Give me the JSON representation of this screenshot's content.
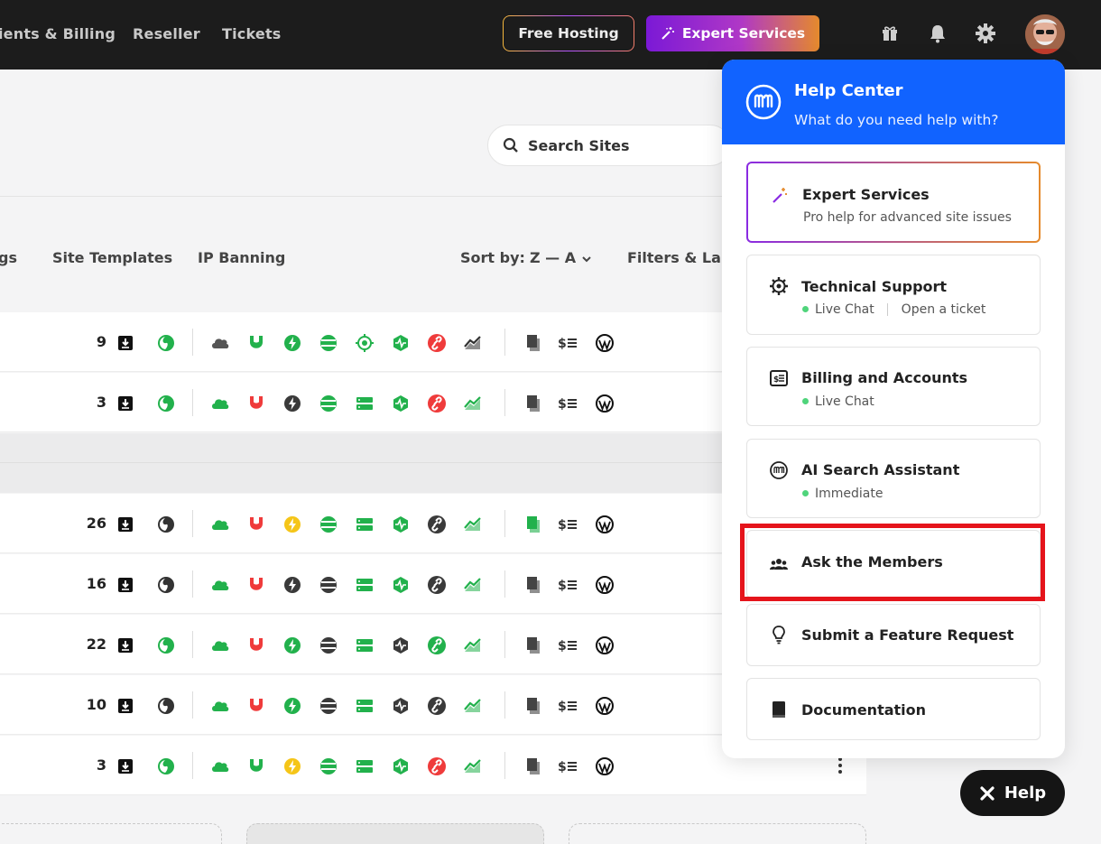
{
  "topnav": {
    "items": [
      "ients & Billing",
      "Reseller",
      "Tickets"
    ],
    "free_hosting": "Free Hosting",
    "expert_services": "Expert Services"
  },
  "search": {
    "placeholder": "Search Sites"
  },
  "toolbar": {
    "tabs": [
      "gs",
      "Site Templates",
      "IP Banning"
    ],
    "sort_label": "Sort by:",
    "sort_value": "Z — A",
    "filters": "Filters & Labe"
  },
  "sites": {
    "group1": [
      {
        "count": "9",
        "icons": [
          "backup-download",
          "globe",
          "cloud",
          "shield",
          "bolt",
          "stack",
          "gear",
          "server",
          "activity",
          "link",
          "chart",
          "copy",
          "billing",
          "wordpress"
        ]
      },
      {
        "count": "3",
        "icons": [
          "backup-download",
          "globe",
          "cloud",
          "shield",
          "bolt",
          "stack",
          "server",
          "activity",
          "link",
          "chart",
          "copy",
          "billing",
          "wordpress"
        ]
      }
    ],
    "group2": [
      {
        "count": "26"
      },
      {
        "count": "16"
      },
      {
        "count": "22"
      },
      {
        "count": "10"
      },
      {
        "count": "3"
      }
    ]
  },
  "help_center": {
    "title": "Help Center",
    "subtitle": "What do you need help with?",
    "cards": {
      "expert": {
        "title": "Expert Services",
        "desc": "Pro help for advanced site issues"
      },
      "technical": {
        "title": "Technical Support",
        "live_chat": "Live Chat",
        "ticket": "Open a ticket"
      },
      "billing": {
        "title": "Billing and Accounts",
        "live_chat": "Live Chat"
      },
      "ai": {
        "title": "AI Search Assistant",
        "status": "Immediate"
      },
      "members": {
        "title": "Ask the Members"
      },
      "feature": {
        "title": "Submit a Feature Request"
      },
      "docs": {
        "title": "Documentation"
      }
    }
  },
  "help_button": {
    "label": "Help"
  },
  "colors": {
    "accent_blue": "#1163ff",
    "status_green": "#22b14c",
    "danger_red": "#ef3b3b",
    "highlight": "#e5141b"
  }
}
